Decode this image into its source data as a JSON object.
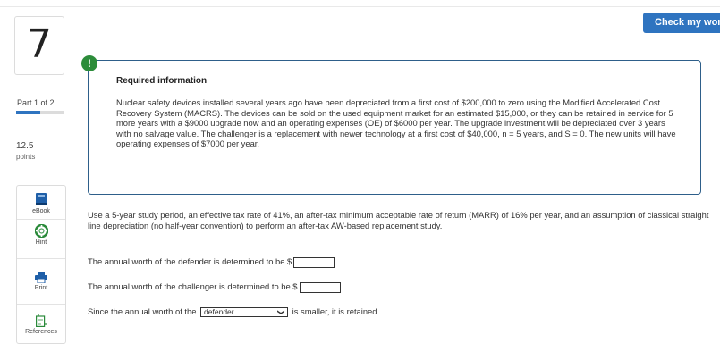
{
  "header": {
    "check_button": "Check my work"
  },
  "sidebar": {
    "question_number": "7",
    "part_label": "Part 1 of 2",
    "progress": 0.5,
    "points_value": "12.5",
    "points_label": "points",
    "tools": [
      {
        "label": "eBook",
        "icon": "book-icon"
      },
      {
        "label": "Hint",
        "icon": "lifebuoy-icon"
      },
      {
        "label": "Print",
        "icon": "printer-icon"
      },
      {
        "label": "References",
        "icon": "documents-icon"
      }
    ]
  },
  "info": {
    "alert_symbol": "!",
    "title": "Required information",
    "text": "Nuclear safety devices installed several years ago have been depreciated from a first cost of $200,000 to zero using the Modified Accelerated Cost Recovery System (MACRS). The devices can be sold on the used equipment market for an estimated $15,000, or they can be retained in service for 5 more years with a $9000 upgrade now and an operating expenses (OE) of $6000 per year. The upgrade investment will be depreciated over 3 years with no salvage value. The challenger is a replacement with newer technology at a first cost of $40,000, n = 5 years, and S = 0. The new units will have operating expenses of $7000 per year."
  },
  "question": {
    "instructions": "Use a 5-year study period, an effective tax rate of 41%, an after-tax minimum acceptable rate of return (MARR) of 16% per year, and an assumption of classical straight line depreciation (no half-year convention) to perform an after-tax AW-based replacement study.",
    "line1_text": "The annual worth of the defender is determined to be $",
    "line1_value": "",
    "line2_text": "The annual worth of the challenger is determined to be $",
    "line2_value": "",
    "line3_prefix": "Since the annual worth of the",
    "line3_selected": "defender",
    "line3_suffix": "is smaller, it is retained.",
    "period": "."
  }
}
